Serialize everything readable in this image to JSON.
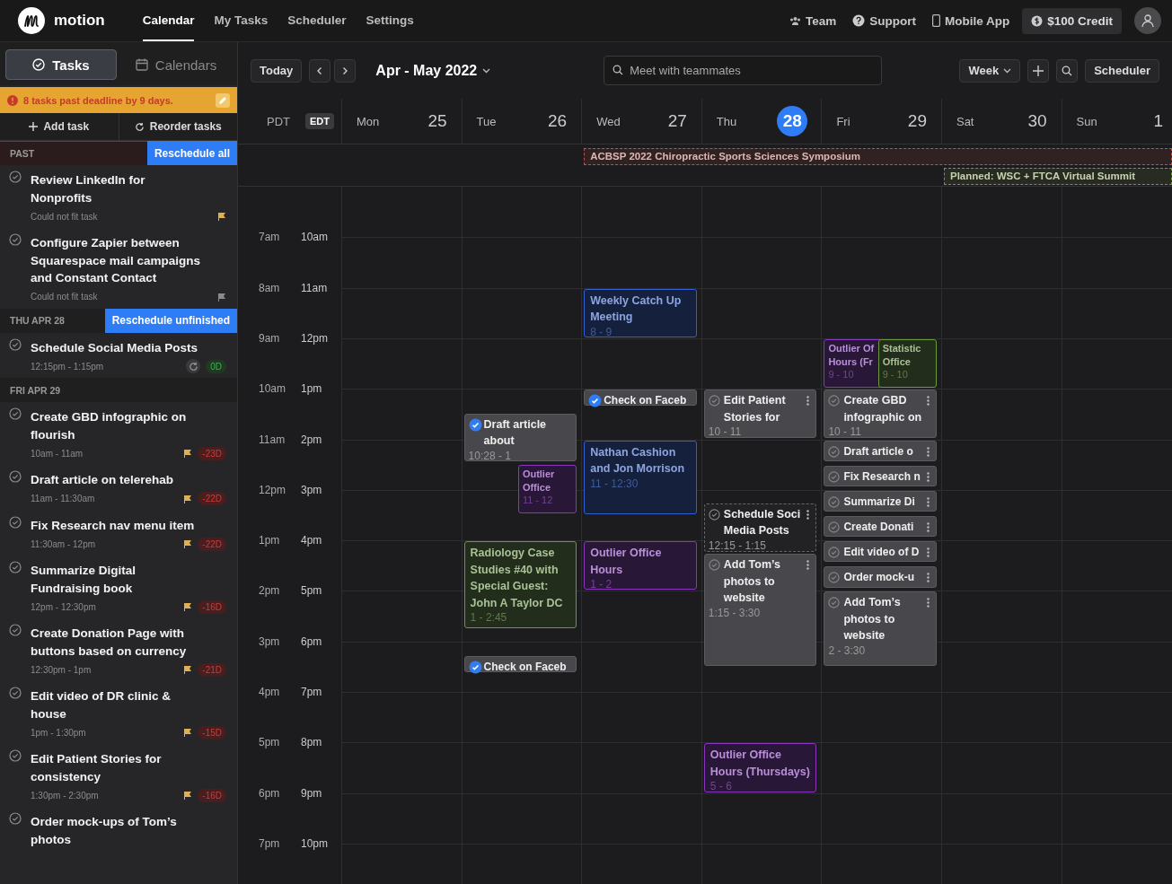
{
  "nav": {
    "brand": "motion",
    "links": [
      {
        "label": "Calendar",
        "selected": true
      },
      {
        "label": "My Tasks",
        "selected": false
      },
      {
        "label": "Scheduler",
        "selected": false
      },
      {
        "label": "Settings",
        "selected": false
      }
    ],
    "right": [
      {
        "label": "Team",
        "kind": "team"
      },
      {
        "label": "Support",
        "kind": "support"
      },
      {
        "label": "Mobile App",
        "kind": "mobile"
      }
    ],
    "credit": "$100 Credit"
  },
  "sidebar": {
    "tabs": [
      {
        "label": "Tasks",
        "kind": "tasks",
        "selected": true
      },
      {
        "label": "Calendars",
        "kind": "calendars",
        "selected": false
      }
    ],
    "banner": "8 tasks past deadline by 9 days.",
    "actions": [
      {
        "label": "Add task",
        "kind": "add"
      },
      {
        "label": "Reorder tasks",
        "kind": "reorder"
      }
    ],
    "sections": [
      {
        "title": "PAST",
        "button": "Reschedule all",
        "past": true,
        "tasks": [
          {
            "title": "Review LinkedIn for Nonprofits",
            "subtitle": "Could not fit task",
            "flag": {
              "color": "#e0b050"
            },
            "recurring": false
          },
          {
            "title": "Configure Zapier between Squarespace mail campaigns and Constant Contact",
            "subtitle": "Could not fit task",
            "flag": {
              "color": "#8a8a8a"
            },
            "recurring": false
          }
        ]
      },
      {
        "title": "THU APR 28",
        "button": "Reschedule unfinished",
        "past": false,
        "tasks": [
          {
            "title": "Schedule Social Media Posts",
            "subtitle": "12:15pm - 1:15pm",
            "recurring": true,
            "badge": "0D",
            "overdue": false
          }
        ]
      },
      {
        "title": "FRI APR 29",
        "past": false,
        "tasks": [
          {
            "title": "Create GBD infographic on flourish",
            "subtitle": "10am - 11am",
            "flag": {
              "color": "#e0b050"
            },
            "recurring": false,
            "badge": "-23D",
            "overdue": true
          },
          {
            "title": "Draft article on telerehab",
            "subtitle": "11am - 11:30am",
            "flag": {
              "color": "#e0b050"
            },
            "recurring": false,
            "badge": "-22D",
            "overdue": true
          },
          {
            "title": "Fix Research nav menu item",
            "subtitle": "11:30am - 12pm",
            "flag": {
              "color": "#e0b050"
            },
            "recurring": false,
            "badge": "-22D",
            "overdue": true
          },
          {
            "title": "Summarize Digital Fundraising book",
            "subtitle": "12pm - 12:30pm",
            "flag": {
              "color": "#e0b050"
            },
            "recurring": false,
            "badge": "-16D",
            "overdue": true
          },
          {
            "title": "Create Donation Page with buttons based on currency",
            "subtitle": "12:30pm - 1pm",
            "flag": {
              "color": "#e0b050"
            },
            "recurring": false,
            "badge": "-21D",
            "overdue": true
          },
          {
            "title": "Edit video of DR clinic & house",
            "subtitle": "1pm - 1:30pm",
            "flag": {
              "color": "#e0b050"
            },
            "recurring": false,
            "badge": "-15D",
            "overdue": true
          },
          {
            "title": "Edit Patient Stories for consistency",
            "subtitle": "1:30pm - 2:30pm",
            "flag": {
              "color": "#e0b050"
            },
            "recurring": false,
            "badge": "-16D",
            "overdue": true
          },
          {
            "title": "Order mock-ups of Tom’s photos",
            "recurring": false
          }
        ]
      }
    ]
  },
  "calendar": {
    "toolbar": {
      "today": "Today",
      "range": "Apr - May 2022",
      "search_placeholder": "Meet with teammates",
      "view": "Week",
      "scheduler": "Scheduler"
    },
    "timezones": [
      {
        "label": "PDT",
        "selected": false
      },
      {
        "label": "EDT",
        "selected": true
      }
    ],
    "days": [
      {
        "name": "Mon",
        "date": "25",
        "today": false
      },
      {
        "name": "Tue",
        "date": "26",
        "today": false
      },
      {
        "name": "Wed",
        "date": "27",
        "today": false
      },
      {
        "name": "Thu",
        "date": "28",
        "today": true
      },
      {
        "name": "Fri",
        "date": "29",
        "today": false
      },
      {
        "name": "Sat",
        "date": "30",
        "today": false
      },
      {
        "name": "Sun",
        "date": "1",
        "today": false
      }
    ],
    "all_day": [
      {
        "title": "ACBSP 2022 Chiropractic Sports Sciences Symposium",
        "color": "#c0504a"
      },
      {
        "title": "Planned: WSC + FTCA Virtual Summit",
        "color": "#7a9a3a"
      }
    ],
    "hours": [
      {
        "primary": "7am",
        "secondary": "10am"
      },
      {
        "primary": "8am",
        "secondary": "11am"
      },
      {
        "primary": "9am",
        "secondary": "12pm"
      },
      {
        "primary": "10am",
        "secondary": "1pm"
      },
      {
        "primary": "11am",
        "secondary": "2pm"
      },
      {
        "primary": "12pm",
        "secondary": "3pm"
      },
      {
        "primary": "1pm",
        "secondary": "4pm"
      },
      {
        "primary": "2pm",
        "secondary": "5pm"
      },
      {
        "primary": "3pm",
        "secondary": "6pm"
      },
      {
        "primary": "4pm",
        "secondary": "7pm"
      },
      {
        "primary": "5pm",
        "secondary": "8pm"
      },
      {
        "primary": "6pm",
        "secondary": "9pm"
      },
      {
        "primary": "7pm",
        "secondary": "10pm"
      }
    ],
    "events": [
      {
        "kind": "task",
        "title": "Draft article about",
        "time": "10:28 - 1",
        "checked": true
      },
      {
        "kind": "event",
        "title": "Outlier Office",
        "time": "11 - 12",
        "color": "#8a35c0"
      },
      {
        "kind": "event",
        "title": "Radiology Case Studies #40 with Special Guest: John A Taylor DC",
        "time": "1 - 2:45",
        "color": "#6a9a3a"
      },
      {
        "kind": "task",
        "title": "Check on Faceb",
        "checked": true
      },
      {
        "kind": "event",
        "title": "Weekly Catch Up Meeting",
        "time": "8 - 9",
        "color": "#2f5fd0"
      },
      {
        "kind": "task",
        "title": "Check on Faceb",
        "checked": true
      },
      {
        "kind": "event",
        "title": "Nathan Cashion and Jon Morrison",
        "time": "11 - 12:30",
        "color": "#2f5fd0"
      },
      {
        "kind": "event",
        "title": "Outlier Office Hours",
        "time": "1 - 2",
        "color": "#8a35c0"
      },
      {
        "kind": "task",
        "title": "Edit Patient Stories for",
        "time": "10 - 11",
        "checked": false
      },
      {
        "kind": "pending",
        "title": "Schedule Soci Media Posts",
        "time": "12:15 - 1:15",
        "checked": false
      },
      {
        "kind": "task",
        "title": "Add Tom’s photos to website",
        "time": "1:15 - 3:30",
        "checked": false
      },
      {
        "kind": "event",
        "title": "Outlier Office Hours (Thursdays)",
        "time": "5 - 6",
        "color": "#8a35c0"
      },
      {
        "kind": "event",
        "title": "Outlier Of Hours (Fr",
        "time": "9 - 10",
        "color": "#8a35c0"
      },
      {
        "kind": "event",
        "title": "Statistic Office",
        "time": "9 - 10",
        "color": "#6a9a3a"
      },
      {
        "kind": "task",
        "title": "Create GBD infographic on",
        "time": "10 - 11",
        "checked": false
      },
      {
        "kind": "task",
        "title": "Draft article o",
        "checked": false
      },
      {
        "kind": "task",
        "title": "Fix Research n",
        "checked": false
      },
      {
        "kind": "task",
        "title": "Summarize Di",
        "checked": false
      },
      {
        "kind": "task",
        "title": "Create Donati",
        "checked": false
      },
      {
        "kind": "task",
        "title": "Edit video of D",
        "checked": false
      },
      {
        "kind": "task",
        "title": "Order mock-u",
        "checked": false
      },
      {
        "kind": "task",
        "title": "Add Tom’s photos to website",
        "time": "2 - 3:30",
        "checked": false
      }
    ]
  }
}
